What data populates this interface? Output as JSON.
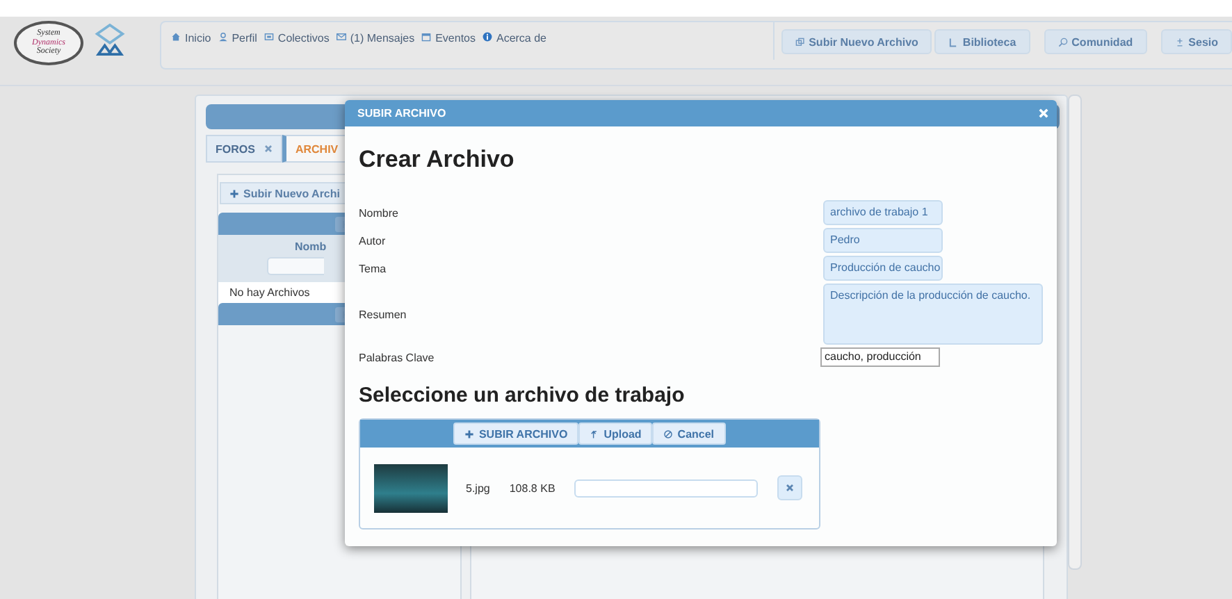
{
  "header": {
    "logo_text": [
      "System",
      "Dynamics",
      "Society"
    ],
    "nav": [
      {
        "kind": "home",
        "label": "Inicio"
      },
      {
        "kind": "user",
        "label": "Perfil"
      },
      {
        "kind": "group",
        "label": "Colectivos"
      },
      {
        "kind": "mail",
        "label": "(1) Mensajes"
      },
      {
        "kind": "calendar",
        "label": "Eventos"
      },
      {
        "kind": "info",
        "label": "Acerca de"
      }
    ],
    "actions": [
      {
        "kind": "copy",
        "label": "Subir Nuevo Archivo"
      },
      {
        "kind": "book",
        "label": "Biblioteca"
      },
      {
        "kind": "search",
        "label": "Comunidad"
      },
      {
        "kind": "plusminus",
        "label": "Sesio"
      }
    ]
  },
  "tabs": [
    {
      "label": "FOROS",
      "selected": false,
      "closable": true
    },
    {
      "label": "ARCHIV",
      "selected": true,
      "closable": false
    }
  ],
  "files_panel": {
    "new_button": "Subir Nuevo Archi",
    "column": "Nomb",
    "empty_message": "No hay Archivos"
  },
  "dialog": {
    "title": "SUBIR ARCHIVO",
    "heading": "Crear Archivo",
    "fields": [
      {
        "kind": "text",
        "label": "Nombre",
        "value": "archivo de trabajo 1"
      },
      {
        "kind": "text",
        "label": "Autor",
        "value": "Pedro"
      },
      {
        "kind": "text",
        "label": "Tema",
        "value": "Producción de caucho"
      },
      {
        "kind": "textarea",
        "label": "Resumen",
        "value": "Descripción de la producción de caucho."
      },
      {
        "kind": "input",
        "label": "Palabras Clave",
        "value": "caucho, producción"
      }
    ],
    "upload_heading": "Seleccione un archivo de trabajo",
    "upload_buttons": [
      {
        "kind": "plus",
        "label": "SUBIR ARCHIVO"
      },
      {
        "kind": "arrow",
        "label": "Upload"
      },
      {
        "kind": "cancel",
        "label": "Cancel"
      }
    ],
    "files": [
      {
        "name": "5.jpg",
        "size": "108.8 KB"
      }
    ]
  }
}
